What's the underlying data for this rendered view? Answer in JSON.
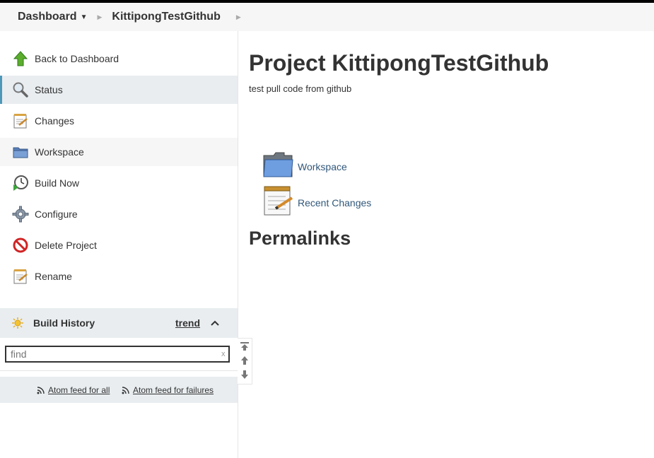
{
  "breadcrumb": {
    "dashboard": "Dashboard",
    "project": "KittipongTestGithub"
  },
  "sidebar": {
    "tasks": [
      {
        "label": "Back to Dashboard",
        "icon": "up-arrow-icon"
      },
      {
        "label": "Status",
        "icon": "magnifier-icon"
      },
      {
        "label": "Changes",
        "icon": "notepad-icon"
      },
      {
        "label": "Workspace",
        "icon": "folder-icon"
      },
      {
        "label": "Build Now",
        "icon": "clock-play-icon"
      },
      {
        "label": "Configure",
        "icon": "gear-icon"
      },
      {
        "label": "Delete Project",
        "icon": "no-entry-icon"
      },
      {
        "label": "Rename",
        "icon": "notepad-icon"
      }
    ]
  },
  "build_history": {
    "title": "Build History",
    "trend": "trend",
    "find_placeholder": "find",
    "clear": "x",
    "feed_all": "Atom feed for all",
    "feed_failures": "Atom feed for failures"
  },
  "main": {
    "title": "Project KittipongTestGithub",
    "description": "test pull code from github",
    "workspace_link": "Workspace",
    "recent_changes_link": "Recent Changes",
    "permalinks_heading": "Permalinks"
  },
  "colors": {
    "link": "#31587a",
    "active_bg": "#e9edf0",
    "active_border": "#4d98b8"
  }
}
